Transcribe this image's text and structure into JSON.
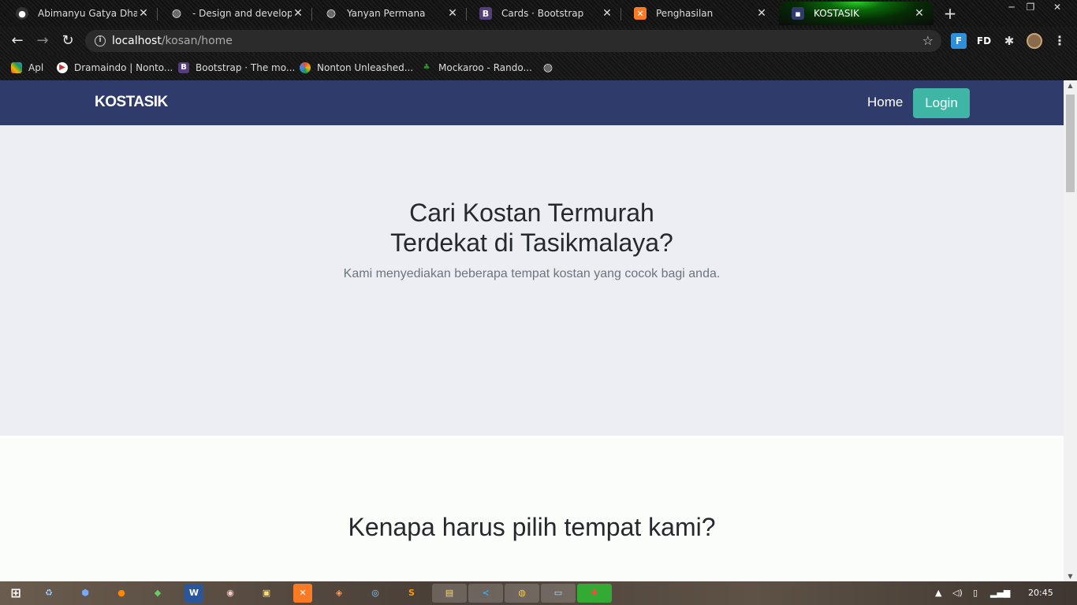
{
  "browser": {
    "tabs": [
      {
        "title": "Abimanyu Gatya Dhanes",
        "icon": "github-icon",
        "color": "#333333",
        "active": false
      },
      {
        "title": "- Design and develop br",
        "icon": "globe-icon",
        "color": "#e6e6e6",
        "active": false
      },
      {
        "title": "Yanyan Permana",
        "icon": "globe-icon",
        "color": "#e6e6e6",
        "active": false
      },
      {
        "title": "Cards · Bootstrap",
        "icon": "bootstrap-icon",
        "color": "#563d7c",
        "active": false
      },
      {
        "title": "Penghasilan",
        "icon": "xampp-icon",
        "color": "#fb7a24",
        "active": false
      },
      {
        "title": "KOSTASIK",
        "icon": "site-icon",
        "color": "#2f3b6b",
        "active": true
      }
    ],
    "new_tab": "+",
    "window_controls": {
      "minimize": "─",
      "restore": "❐",
      "close": "✕"
    },
    "address": {
      "host": "localhost",
      "path": "/kosan/home"
    },
    "extensions": [
      {
        "name": "fi-extension-icon",
        "label": "F",
        "color": "#2f8fd8"
      },
      {
        "name": "fd-extension-icon",
        "label": "FD",
        "color": "#ffffff"
      },
      {
        "name": "puzzle-icon",
        "label": "✱",
        "color": "#dddddd"
      }
    ],
    "bookmarks": [
      {
        "label": "Apl",
        "icon": "apps-grid-icon",
        "color": "#e0533d"
      },
      {
        "label": "Dramaindo | Nonto...",
        "icon": "play-icon",
        "color": "#ffffff"
      },
      {
        "label": "Bootstrap · The mo...",
        "icon": "bootstrap-icon",
        "color": "#563d7c"
      },
      {
        "label": "Nonton Unleashed...",
        "icon": "pinwheel-icon",
        "color": "#e84c3d"
      },
      {
        "label": "Mockaroo - Rando...",
        "icon": "mockaroo-icon",
        "color": "#2a8f2a"
      },
      {
        "label": "",
        "icon": "globe-icon",
        "color": "#dddddd"
      }
    ]
  },
  "site": {
    "brand": "KOSTASIK",
    "nav": {
      "home": "Home",
      "login": "Login"
    },
    "hero": {
      "title_line1": "Cari Kostan Termurah",
      "title_line2": "Terdekat di Tasikmalaya?",
      "subtitle": "Kami menyediakan beberapa tempat kostan yang cocok bagi anda."
    },
    "section2": {
      "heading": "Kenapa harus pilih tempat kami?"
    },
    "colors": {
      "navbar": "#2f3b6b",
      "login_button": "#3fb5a6",
      "hero_bg": "#eceef3"
    }
  },
  "taskbar": {
    "clock": "20:45",
    "apps": [
      "windows-start-icon",
      "recycle-icon",
      "box-icon",
      "firefox-icon",
      "spreadsheet-icon",
      "word-icon",
      "media-icon",
      "files-icon",
      "xampp-icon",
      "git-icon",
      "network-icon",
      "sublime-icon",
      "explorer-icon",
      "vscode-icon",
      "chrome-icon",
      "notepad-icon",
      "app-red-icon"
    ]
  }
}
